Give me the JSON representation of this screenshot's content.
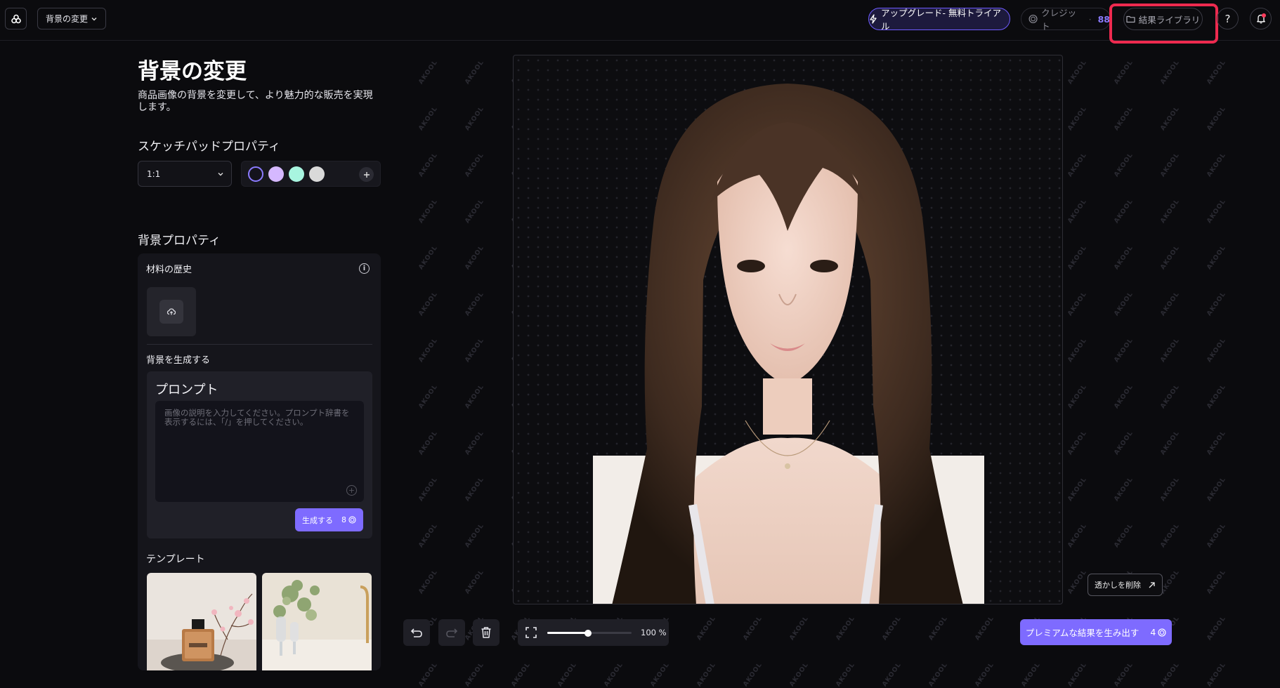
{
  "header": {
    "tool_select_label": "背景の変更",
    "upgrade_label": "アップグレード- 無料トライアル",
    "credits_label": "クレジット",
    "credits_value": "88",
    "library_label": "結果ライブラリ",
    "help_label": "?"
  },
  "left_panel": {
    "title": "背景の変更",
    "description": "商品画像の背景を変更して、より魅力的な販売を実現します。",
    "sketchpad_title": "スケッチパッドプロパティ",
    "ratio_value": "1:1",
    "colors": [
      "#14131c",
      "#d5b8ff",
      "#a8f5e0",
      "#d9d9d9"
    ],
    "bg_props_title": "背景プロパティ",
    "material_history_label": "材料の歴史",
    "generate_bg_label": "背景を生成する",
    "prompt_title": "プロンプト",
    "prompt_placeholder": "画像の説明を入力してください。プロンプト辞書を表示するには、「/」を押してください。",
    "generate_button_label": "生成する",
    "generate_cost": "8",
    "templates_label": "テンプレート"
  },
  "canvas": {
    "watermark_text": "AKOOL",
    "remove_watermark_label": "透かしを削除",
    "zoom_label": "100 %",
    "zoom_level": 0.48
  },
  "bottom": {
    "premium_label": "プレミアムな結果を生み出す",
    "premium_cost": "4"
  },
  "colors": {
    "accent": "#7e6bff",
    "highlight": "#ee2a4f"
  }
}
